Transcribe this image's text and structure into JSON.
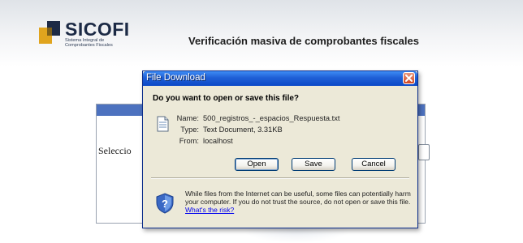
{
  "header": {
    "logo_word": "SICOFI",
    "logo_sub": "Sistema Integral de\nComprobantes Fiscales",
    "title": "Verificación masiva de comprobantes fiscales"
  },
  "page": {
    "select_label": "Seleccio"
  },
  "dialog": {
    "title": "File Download",
    "question": "Do you want to open or save this file?",
    "name_label": "Name:",
    "name_value": "500_registros_-_espacios_Respuesta.txt",
    "type_label": "Type:",
    "type_value": "Text Document, 3.31KB",
    "from_label": "From:",
    "from_value": "localhost",
    "open_label": "Open",
    "save_label": "Save",
    "cancel_label": "Cancel",
    "warning_text": "While files from the Internet can be useful, some files can potentially harm your computer. If you do not trust the source, do not open or save this file.",
    "risk_link": "What's the risk?"
  },
  "colors": {
    "titlebar": "#0b48c7",
    "dialog_bg": "#ece9d8",
    "panel_bar": "#4d72bf"
  }
}
